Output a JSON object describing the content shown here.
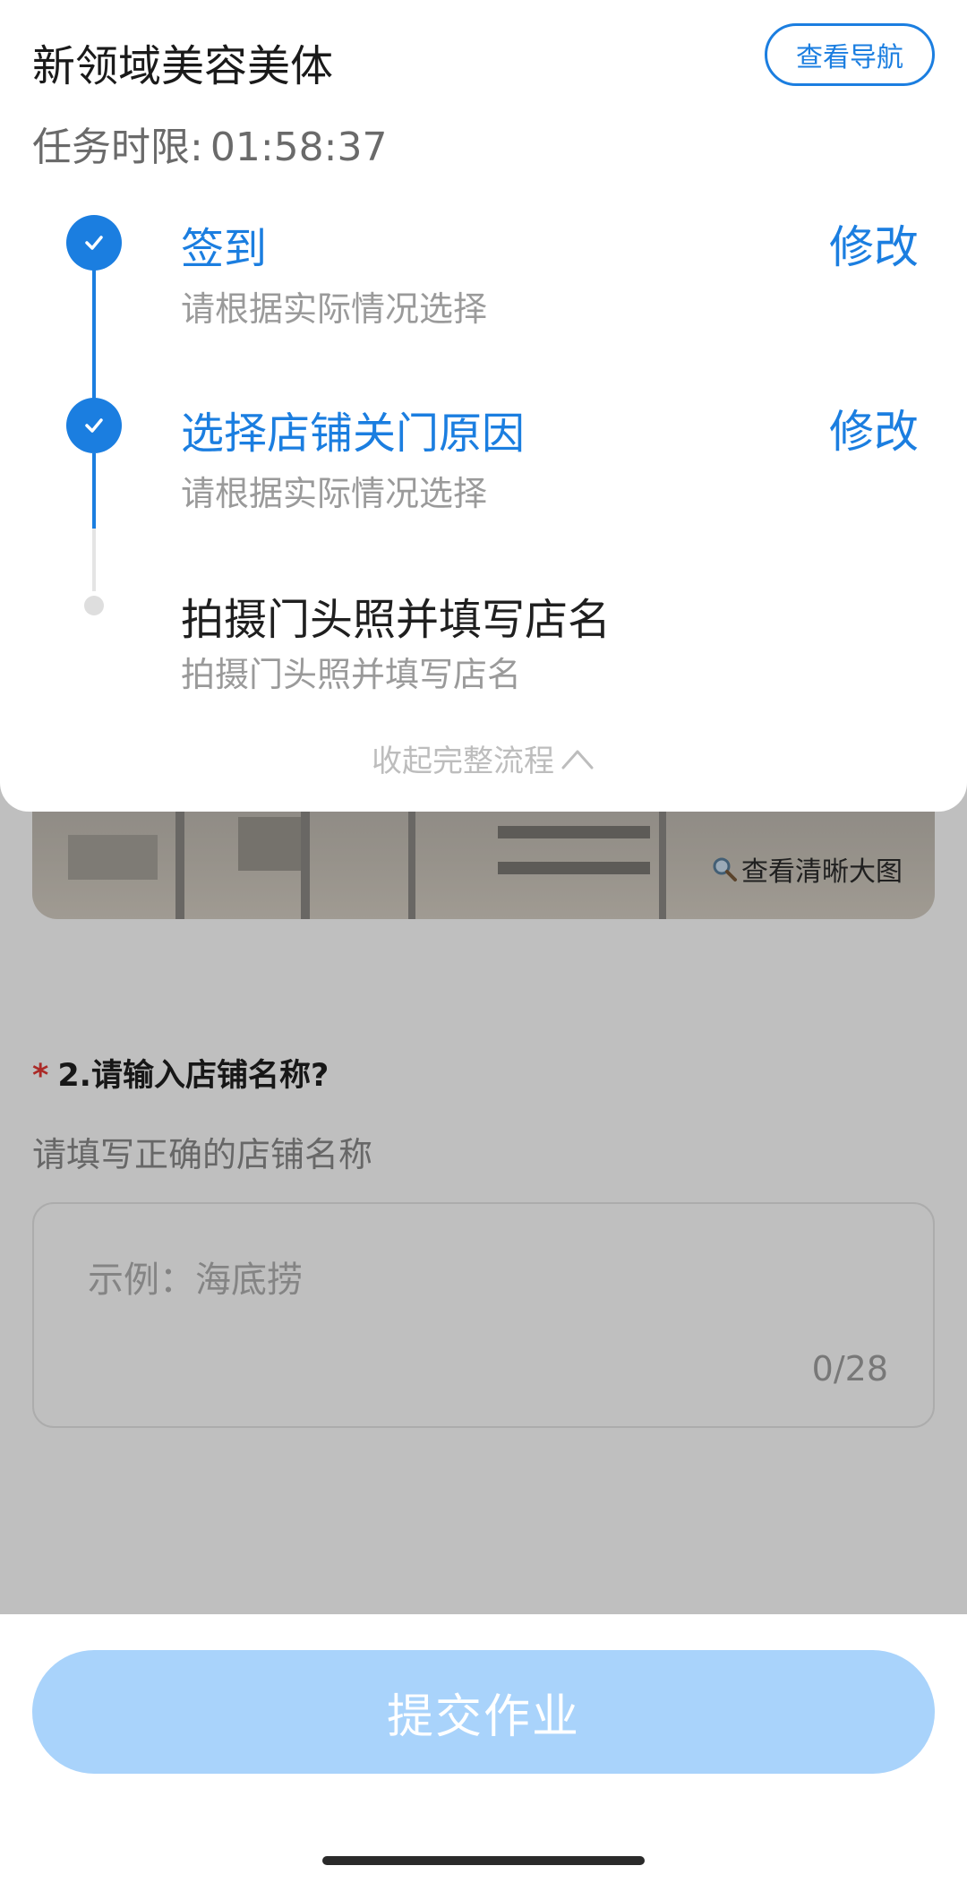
{
  "header": {
    "store_name": "新领域美容美体",
    "nav_button_label": "查看导航",
    "deadline_label": "任务时限:",
    "deadline_value": "01:58:37"
  },
  "steps": [
    {
      "title": "签到",
      "subtitle": "请根据实际情况选择",
      "status": "done",
      "action": "修改"
    },
    {
      "title": "选择店铺关门原因",
      "subtitle": "请根据实际情况选择",
      "status": "done",
      "action": "修改"
    },
    {
      "title": "拍摄门头照并填写店名",
      "subtitle": "拍摄门头照并填写店名",
      "status": "pending"
    }
  ],
  "collapse_label": "收起完整流程",
  "photo": {
    "view_large_label": "查看清晰大图"
  },
  "question": {
    "required_mark": "*",
    "title": "2.请输入店铺名称?",
    "description": "请填写正确的店铺名称",
    "placeholder": "示例：海底捞",
    "char_count": "0/28"
  },
  "submit": {
    "label": "提交作业"
  },
  "colors": {
    "accent": "#1b7ee0",
    "submit_disabled": "#a9d3fb"
  },
  "icons": [
    "check-icon",
    "chevron-up-icon",
    "magnifier-icon"
  ]
}
